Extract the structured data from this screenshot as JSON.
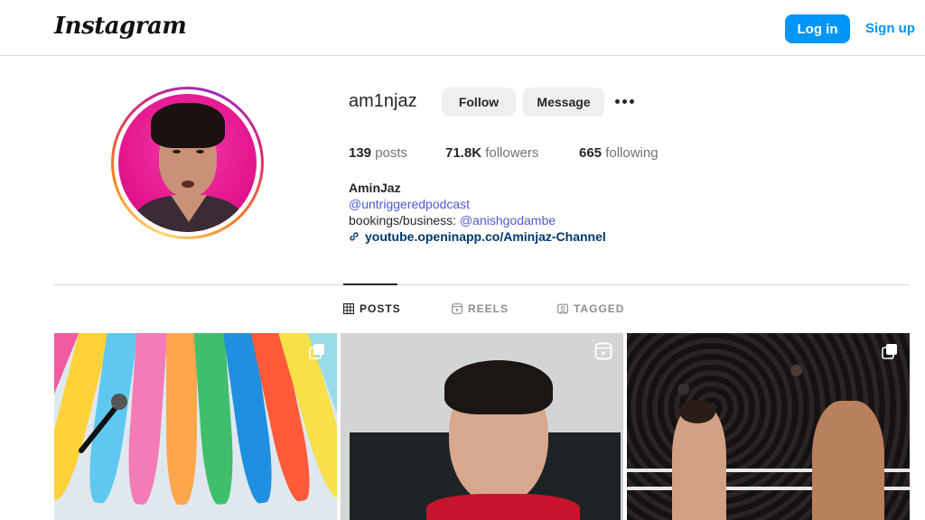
{
  "header": {
    "logo_text": "Instagram",
    "login_label": "Log in",
    "signup_label": "Sign up"
  },
  "profile": {
    "username": "am1njaz",
    "follow_label": "Follow",
    "message_label": "Message",
    "stats": {
      "posts_count": "139",
      "posts_label": "posts",
      "followers_count": "71.8K",
      "followers_label": "followers",
      "following_count": "665",
      "following_label": "following"
    },
    "full_name": "AminJaz",
    "bio_mention": "@untriggeredpodcast",
    "bio_business_prefix": "bookings/business: ",
    "bio_business_mention": "@anishgodambe",
    "bio_link": "youtube.openinapp.co/Aminjaz-Channel"
  },
  "tabs": {
    "posts": "POSTS",
    "reels": "REELS",
    "tagged": "TAGGED"
  },
  "colors": {
    "primary_blue": "#0095f6",
    "mention_blue": "#4d5bd5",
    "link_navy": "#00376b"
  }
}
